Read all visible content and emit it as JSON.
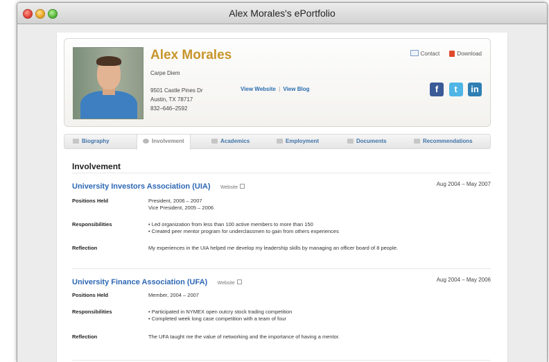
{
  "window": {
    "title": "Alex Morales's ePortfolio"
  },
  "profile": {
    "name": "Alex Morales",
    "motto": "Carpe Diem",
    "address_line1": "9501 Castle Pines Dr",
    "address_line2": "Austin, TX 78717",
    "phone": "832–646–2592",
    "view_website": "View Website",
    "separator": "|",
    "view_blog": "View Blog",
    "contact_label": "Contact",
    "download_label": "Download",
    "social": [
      "f",
      "t",
      "in"
    ]
  },
  "tabs": [
    {
      "label": "Biography",
      "icon": "book-icon"
    },
    {
      "label": "Involvement",
      "icon": "globe-icon",
      "active": true
    },
    {
      "label": "Academics",
      "icon": "graduation-cap-icon"
    },
    {
      "label": "Employment",
      "icon": "briefcase-icon"
    },
    {
      "label": "Documents",
      "icon": "document-icon"
    },
    {
      "label": "Recommendations",
      "icon": "ribbon-icon"
    }
  ],
  "section": {
    "title": "Involvement"
  },
  "labels": {
    "positions": "Positions Held",
    "responsibilities": "Responsibilities",
    "reflection": "Reflection",
    "website": "Website"
  },
  "orgs": [
    {
      "name": "University Investors Association (UIA)",
      "dates": "Aug 2004 – May 2007",
      "positions": [
        "President, 2006 – 2007",
        "Vice President, 2005 – 2006"
      ],
      "responsibilities": [
        "•  Led organization from less than 100 active members to more than 150",
        "•  Created peer mentor program for underclassmen to gain from others experiences"
      ],
      "reflection": "My experiences in the UIA helped me develop my leadership skills by managing an officer board of 8 people."
    },
    {
      "name": "University Finance Association (UFA)",
      "dates": "Aug 2004 – May 2006",
      "positions": [
        "Member, 2004 – 2007"
      ],
      "responsibilities": [
        "•  Participated in NYMEX open outcry stock trading competition",
        "•  Completed week long case competition with a team of four"
      ],
      "reflection": "The UFA taught me the value of networking and the importance of having a mentor."
    }
  ],
  "colors": {
    "name_gold": "#c8952b",
    "link_blue": "#2d67b3"
  }
}
